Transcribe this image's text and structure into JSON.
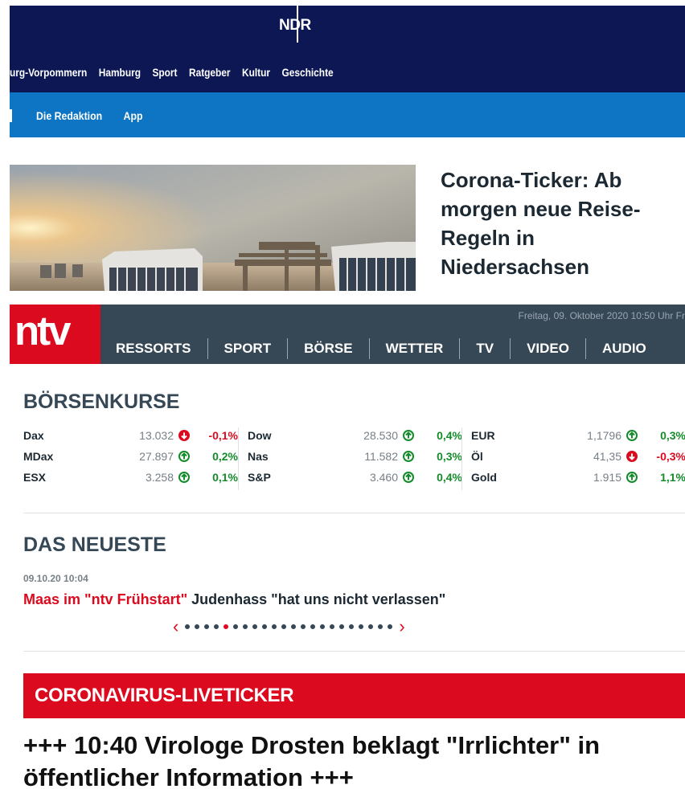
{
  "ndr": {
    "logo": "NDR",
    "nav": [
      "urg-Vorpommern",
      "Hamburg",
      "Sport",
      "Ratgeber",
      "Kultur",
      "Geschichte"
    ],
    "subnav": [
      "Die Redaktion",
      "App"
    ]
  },
  "teaser": {
    "title": "Corona-Ticker: Ab morgen neue Reise-Regeln in Niedersachsen"
  },
  "ntv": {
    "logo": "ntv",
    "date": "Freitag, 09. Oktober 2020 10:50 Uhr Fr",
    "nav": [
      "RESSORTS",
      "SPORT",
      "BÖRSE",
      "WETTER",
      "TV",
      "VIDEO",
      "AUDIO"
    ]
  },
  "boerse": {
    "title": "BÖRSENKURSE",
    "columns": [
      [
        {
          "name": "Dax",
          "value": "13.032",
          "trend": "down",
          "pct": "-0,1%"
        },
        {
          "name": "MDax",
          "value": "27.897",
          "trend": "up",
          "pct": "0,2%"
        },
        {
          "name": "ESX",
          "value": "3.258",
          "trend": "up",
          "pct": "0,1%"
        }
      ],
      [
        {
          "name": "Dow",
          "value": "28.530",
          "trend": "up",
          "pct": "0,4%"
        },
        {
          "name": "Nas",
          "value": "11.582",
          "trend": "up",
          "pct": "0,3%"
        },
        {
          "name": "S&P",
          "value": "3.460",
          "trend": "up",
          "pct": "0,4%"
        }
      ],
      [
        {
          "name": "EUR",
          "value": "1,1796",
          "trend": "up",
          "pct": "0,3%"
        },
        {
          "name": "Öl",
          "value": "41,35",
          "trend": "down",
          "pct": "-0,3%"
        },
        {
          "name": "Gold",
          "value": "1.915",
          "trend": "up",
          "pct": "1,1%"
        }
      ]
    ]
  },
  "neueste": {
    "title": "DAS NEUESTE",
    "time": "09.10.20 10:04",
    "kicker": "Maas im \"ntv Frühstart\"",
    "headline": "Judenhass \"hat uns nicht verlassen\"",
    "prev": "‹",
    "next": "›",
    "dot_count": 22,
    "active_dot": 4
  },
  "liveticker": {
    "label": "CORONAVIRUS-LIVETICKER",
    "headline": "+++ 10:40 Virologe Drosten beklagt \"Irrlichter\" in öffentlicher Information +++"
  },
  "colors": {
    "ndr_dark": "#0c1753",
    "ndr_blue": "#0d75c3",
    "ntv_red": "#dc0a1e",
    "ntv_slate": "#364756",
    "up_green": "#138b29"
  }
}
